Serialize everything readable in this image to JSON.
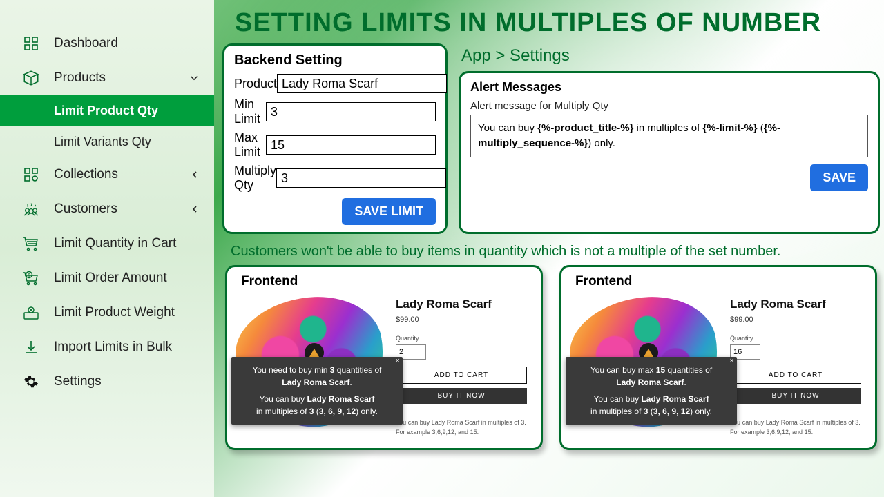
{
  "page_title": "SETTING LIMITS IN MULTIPLES OF NUMBER",
  "sidebar": {
    "items": [
      {
        "label": "Dashboard"
      },
      {
        "label": "Products"
      },
      {
        "label": "Collections"
      },
      {
        "label": "Customers"
      },
      {
        "label": "Limit Quantity in Cart"
      },
      {
        "label": "Limit Order Amount"
      },
      {
        "label": "Limit Product Weight"
      },
      {
        "label": "Import Limits in Bulk"
      },
      {
        "label": "Settings"
      }
    ],
    "products_sub": [
      {
        "label": "Limit Product Qty"
      },
      {
        "label": "Limit Variants Qty"
      }
    ]
  },
  "backend": {
    "title": "Backend Setting",
    "fields": {
      "product_label": "Product",
      "product_value": "Lady Roma Scarf",
      "min_label": "Min Limit",
      "min_value": "3",
      "max_label": "Max Limit",
      "max_value": "15",
      "mult_label": "Multiply Qty",
      "mult_value": "3"
    },
    "save_label": "SAVE LIMIT"
  },
  "breadcrumb": "App > Settings",
  "alert": {
    "title": "Alert Messages",
    "sub": "Alert message for Multiply Qty",
    "text_part1": "You can buy ",
    "token1": "{%-product_title-%}",
    "text_part2": " in multiples of ",
    "token2": "{%-limit-%}",
    "text_part3": " (",
    "token3": "{%-multiply_sequence-%}",
    "text_part4": ") only.",
    "save_label": "SAVE"
  },
  "caption": "Customers won't be able to buy items in quantity which is not a multiple of the set number.",
  "frontend": {
    "title": "Frontend",
    "product_name": "Lady Roma Scarf",
    "price": "$99.00",
    "qty_label": "Quantity",
    "add_label": "ADD TO CART",
    "buy_label": "BUY IT NOW",
    "hint1": "You can buy Lady Roma Scarf in multiples of 3.",
    "hint2": "For example 3,6,9,12, and 15.",
    "left": {
      "qty": "2",
      "toast_l1": "You need to buy min ",
      "toast_b1": "3",
      "toast_l1b": " quantities of",
      "toast_b2": "Lady Roma Scarf",
      "toast_l2a": "You can buy ",
      "toast_b3": "Lady Roma Scarf",
      "toast_l3a": "in multiples of ",
      "toast_b4": "3",
      "toast_l3b": " (",
      "toast_b5": "3, 6, 9, 12",
      "toast_l3c": ") only."
    },
    "right": {
      "qty": "16",
      "toast_l1": "You can buy max ",
      "toast_b1": "15",
      "toast_l1b": " quantities of",
      "toast_b2": "Lady Roma Scarf",
      "toast_l2a": "You can buy ",
      "toast_b3": "Lady Roma Scarf",
      "toast_l3a": "in multiples of ",
      "toast_b4": "3",
      "toast_l3b": " (",
      "toast_b5": "3, 6, 9, 12",
      "toast_l3c": ") only."
    }
  }
}
